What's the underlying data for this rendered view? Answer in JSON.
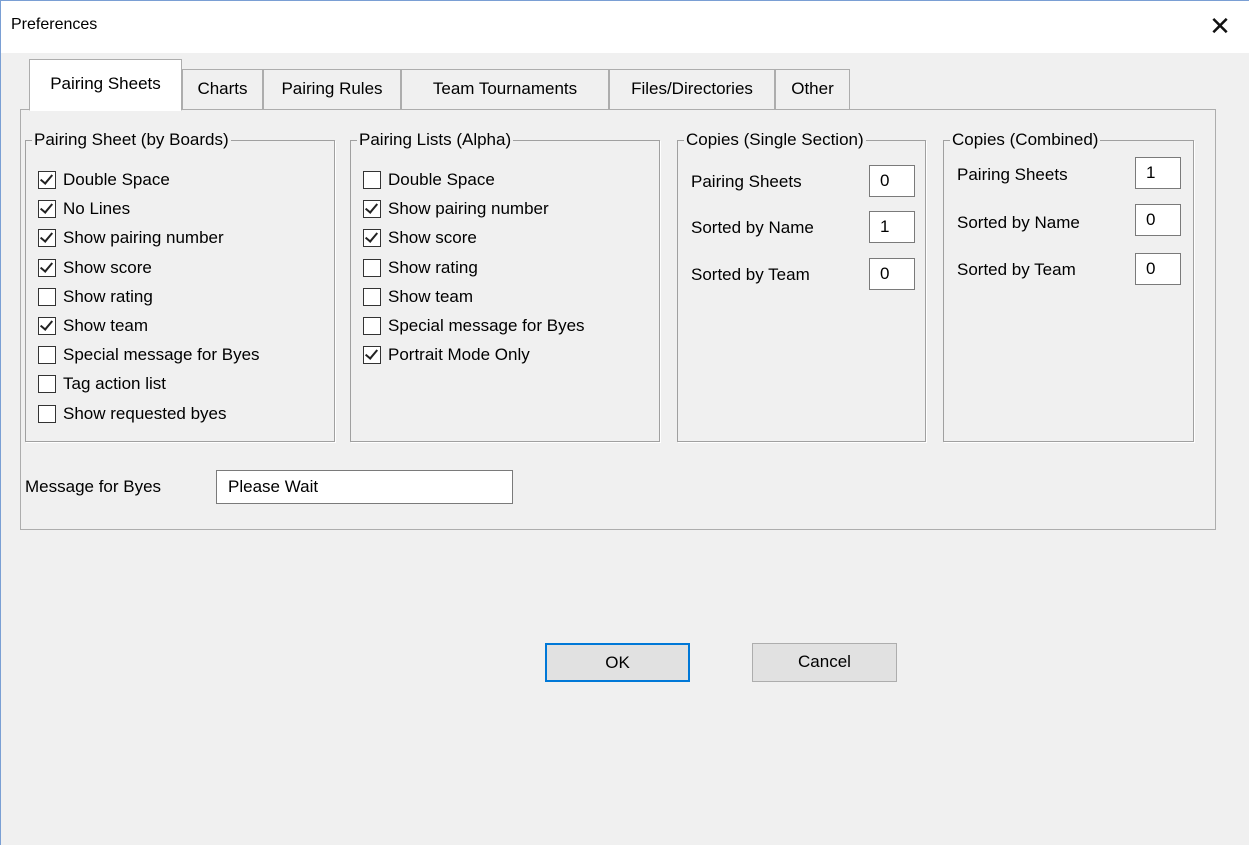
{
  "window": {
    "title": "Preferences",
    "close_glyph": "✕"
  },
  "tabs": [
    {
      "label": "Pairing Sheets",
      "active": true
    },
    {
      "label": "Charts"
    },
    {
      "label": "Pairing Rules"
    },
    {
      "label": "Team Tournaments"
    },
    {
      "label": "Files/Directories"
    },
    {
      "label": "Other"
    }
  ],
  "pairing_sheet": {
    "legend": "Pairing Sheet (by Boards)",
    "items": [
      {
        "label": "Double Space",
        "checked": true
      },
      {
        "label": "No Lines",
        "checked": true
      },
      {
        "label": "Show pairing number",
        "checked": true
      },
      {
        "label": "Show score",
        "checked": true
      },
      {
        "label": "Show rating",
        "checked": false
      },
      {
        "label": "Show team",
        "checked": true
      },
      {
        "label": "Special message for Byes",
        "checked": false
      },
      {
        "label": "Tag action list",
        "checked": false
      },
      {
        "label": "Show requested byes",
        "checked": false
      }
    ]
  },
  "pairing_lists": {
    "legend": "Pairing Lists (Alpha)",
    "items": [
      {
        "label": "Double Space",
        "checked": false
      },
      {
        "label": "Show pairing number",
        "checked": true
      },
      {
        "label": "Show score",
        "checked": true
      },
      {
        "label": "Show rating",
        "checked": false
      },
      {
        "label": "Show team",
        "checked": false
      },
      {
        "label": "Special message for Byes",
        "checked": false
      },
      {
        "label": "Portrait Mode Only",
        "checked": true
      }
    ]
  },
  "copies_single": {
    "legend": "Copies (Single Section)",
    "rows": [
      {
        "label": "Pairing Sheets",
        "value": "0"
      },
      {
        "label": "Sorted by Name",
        "value": "1"
      },
      {
        "label": "Sorted by Team",
        "value": "0"
      }
    ]
  },
  "copies_combined": {
    "legend": "Copies (Combined)",
    "rows": [
      {
        "label": "Pairing Sheets",
        "value": "1"
      },
      {
        "label": "Sorted by Name",
        "value": "0"
      },
      {
        "label": "Sorted by Team",
        "value": "0"
      }
    ]
  },
  "bye_message": {
    "label": "Message for Byes",
    "value": "Please Wait"
  },
  "buttons": {
    "ok": "OK",
    "cancel": "Cancel"
  },
  "colors": {
    "accent": "#0078d7",
    "dialog_bg": "#f0f0f0",
    "border": "#adadad"
  }
}
